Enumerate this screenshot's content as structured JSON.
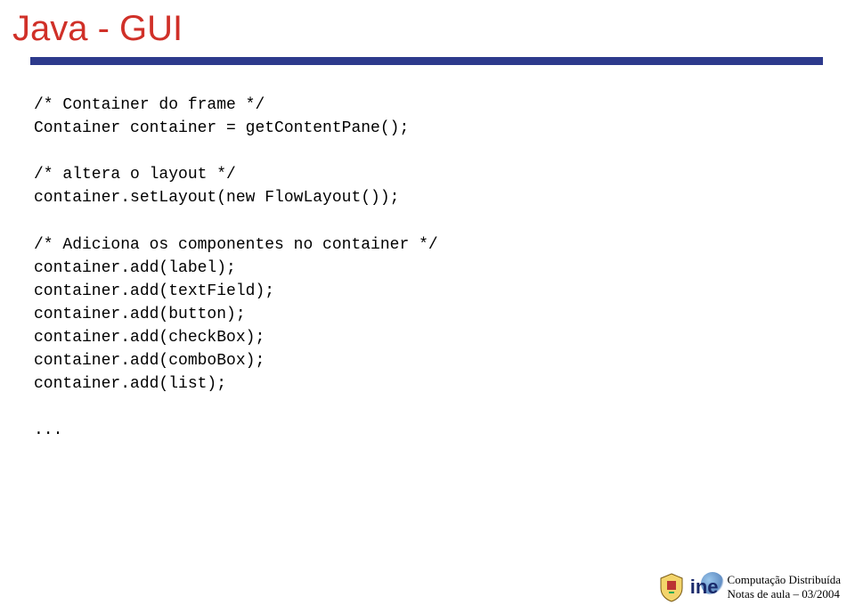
{
  "title": "Java - GUI",
  "code": {
    "c1": "/* Container do frame */",
    "c2": "Container container = getContentPane();",
    "blank1": "",
    "c3": "/* altera o layout */",
    "c4": "container.setLayout(new FlowLayout());",
    "blank2": "",
    "c5": "/* Adiciona os componentes no container */",
    "c6": "container.add(label);",
    "c7": "container.add(textField);",
    "c8": "container.add(button);",
    "c9": "container.add(checkBox);",
    "c10": "container.add(comboBox);",
    "c11": "container.add(list);",
    "blank3": "",
    "c12": "..."
  },
  "footer": {
    "line1": "Computação Distribuída",
    "line2": "Notas de aula  – 03/2004",
    "logo_text": "ine"
  }
}
